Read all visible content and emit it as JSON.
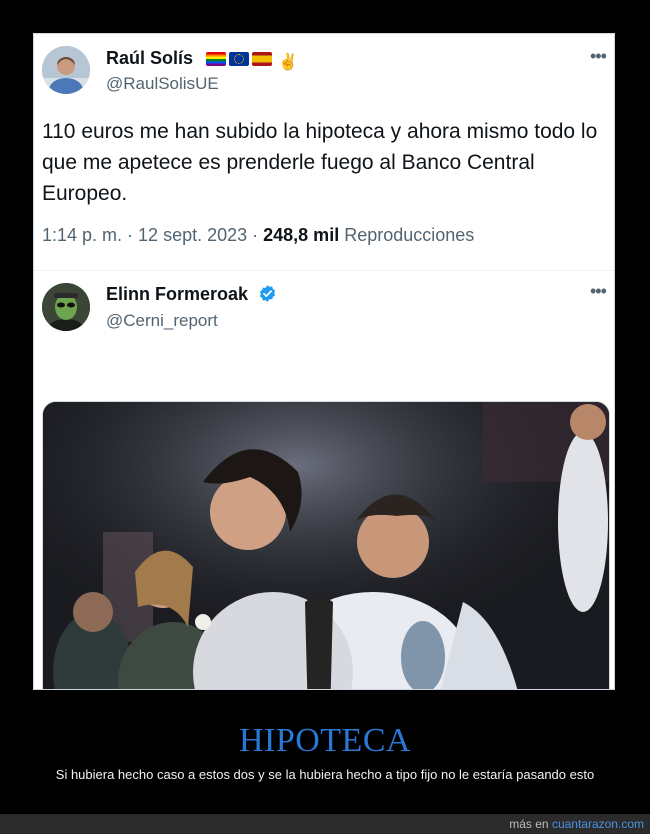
{
  "tweet1": {
    "author_name": "Raúl Solís",
    "handle": "@RaulSolisUE",
    "flags": [
      "rainbow-flag-icon",
      "eu-flag-icon",
      "spain-flag-icon",
      "victory-hand-icon"
    ],
    "text": "110 euros me han subido la hipoteca y ahora mismo todo lo que me apetece es prenderle fuego al Banco Central Europeo.",
    "time": "1:14 p. m.",
    "sep1": " · ",
    "date": "12 sept. 2023",
    "sep2": " · ",
    "views_count": "248,8 mil",
    "views_label": " Reproducciones",
    "more_label": "•••"
  },
  "tweet2": {
    "author_name": "Elinn Formeroak",
    "handle": "@Cerni_report",
    "verified": true,
    "more_label": "•••",
    "media": "photo-of-two-people-at-party"
  },
  "footer": {
    "title": "HIPOTECA",
    "subtitle": "Si hubiera hecho caso a estos dos y se la hubiera hecho a tipo fijo no le estaría pasando esto",
    "credit_prefix": "más en ",
    "credit_site": "cuantarazon.com"
  },
  "colors": {
    "background": "#000000",
    "title": "#2a78d6",
    "verified": "#1d9bf0",
    "link": "#4a93e3"
  }
}
